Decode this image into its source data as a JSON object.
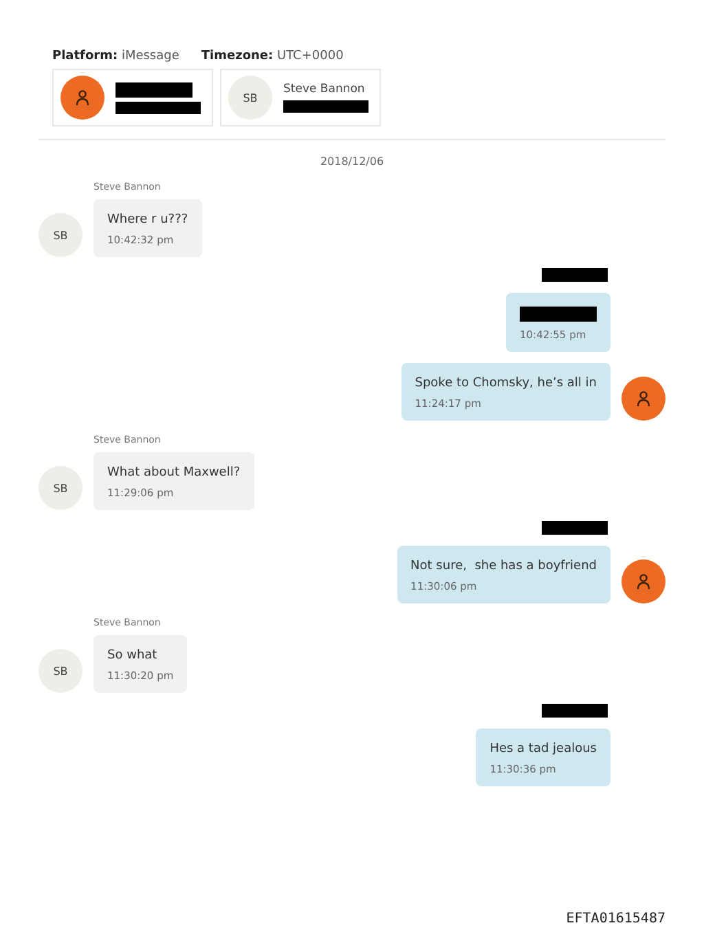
{
  "header": {
    "platform_label": "Platform:",
    "platform": "iMessage",
    "timezone_label": "Timezone:",
    "timezone": "UTC+0000"
  },
  "participants": [
    {
      "kind": "person",
      "name_redacted": true,
      "id_redacted": true
    },
    {
      "kind": "initials",
      "avatar": "SB",
      "name": "Steve Bannon",
      "id_redacted": true
    }
  ],
  "date": "2018/12/06",
  "messages": [
    {
      "kind": "incoming",
      "sender": "Steve Bannon",
      "avatar": "SB",
      "text": "Where r u???",
      "time": "10:42:32 pm"
    },
    {
      "kind": "outgoing",
      "sender_redacted": true,
      "show_avatar": false,
      "text_redacted": true,
      "time": "10:42:55 pm"
    },
    {
      "kind": "outgoing",
      "show_avatar": true,
      "text": "Spoke to Chomsky, he’s all in",
      "time": "11:24:17 pm"
    },
    {
      "kind": "incoming",
      "sender": "Steve Bannon",
      "avatar": "SB",
      "text": "What about Maxwell?",
      "time": "11:29:06 pm"
    },
    {
      "kind": "outgoing",
      "sender_redacted": true,
      "show_avatar": true,
      "text": "Not sure,  she has a boyfriend",
      "time": "11:30:06 pm"
    },
    {
      "kind": "incoming",
      "sender": "Steve Bannon",
      "avatar": "SB",
      "text": "So what",
      "time": "11:30:20 pm"
    },
    {
      "kind": "outgoing",
      "sender_redacted": true,
      "show_avatar": false,
      "text": "Hes a tad jealous",
      "time": "11:30:36 pm"
    }
  ],
  "footer": "EFTA01615487"
}
